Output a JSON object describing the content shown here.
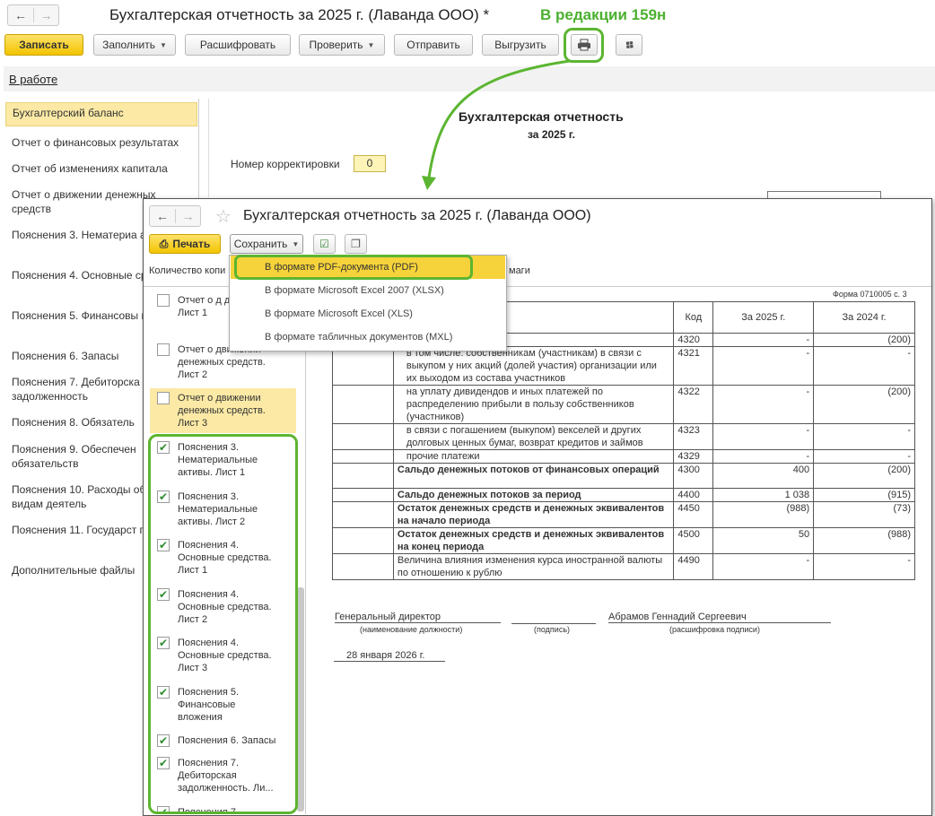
{
  "main_window": {
    "title": "Бухгалтерская отчетность за 2025 г. (Лаванда ООО) *",
    "edition_note": "В редакции 159н",
    "toolbar": {
      "save": "Записать",
      "fill": "Заполнить",
      "decode": "Расшифровать",
      "check": "Проверить",
      "send": "Отправить",
      "export": "Выгрузить"
    },
    "status_link": "В работе",
    "sidebar": [
      "Бухгалтерский баланс",
      "Отчет о финансовых результатах",
      "Отчет об изменениях капитала",
      "Отчет о движении денежных средств",
      "Пояснения 3. Нематериа активы",
      "Пояснения 4. Основные средства",
      "Пояснения 5. Финансовы вложения",
      "Пояснения 6. Запасы",
      "Пояснения 7. Дебиторска задолженность",
      "Пояснения 8. Обязатель",
      "Пояснения 9. Обеспечен обязательств",
      "Пояснения 10. Расходы обычным видам деятель",
      "Пояснения 11. Государст помощь",
      "Дополнительные файлы"
    ],
    "report_title": "Бухгалтерская отчетность",
    "report_year": "за 2025 г.",
    "correction_label": "Номер корректировки",
    "correction_value": "0"
  },
  "print_window": {
    "title": "Бухгалтерская отчетность за 2025 г. (Лаванда ООО)",
    "print_button": "Печать",
    "save_button": "Сохранить",
    "copies_label": "Количество копи",
    "paper_label": "маги",
    "save_menu": [
      "В формате PDF-документа (PDF)",
      "В формате Microsoft Excel 2007 (XLSX)",
      "В формате Microsoft Excel (XLS)",
      "В формате табличных документов (MXL)"
    ],
    "sections": [
      {
        "label": "Отчет о д денежных Лист 1",
        "checked": false
      },
      {
        "label": "Отчет о движении денежных средств. Лист 2",
        "checked": false
      },
      {
        "label": "Отчет о движении денежных средств. Лист 3",
        "checked": false
      },
      {
        "label": "Пояснения 3. Нематериальные активы. Лист 1",
        "checked": true
      },
      {
        "label": "Пояснения 3. Нематериальные активы. Лист 2",
        "checked": true
      },
      {
        "label": "Пояснения 4. Основные средства. Лист 1",
        "checked": true
      },
      {
        "label": "Пояснения 4. Основные средства. Лист 2",
        "checked": true
      },
      {
        "label": "Пояснения 4. Основные средства. Лист 3",
        "checked": true
      },
      {
        "label": "Пояснения 5. Финансовые вложения",
        "checked": true
      },
      {
        "label": "Пояснения 6. Запасы",
        "checked": true
      },
      {
        "label": "Пояснения 7. Дебиторская задолженность. Ли...",
        "checked": true
      },
      {
        "label": "Пояснения 7.",
        "checked": true
      }
    ],
    "form_code": "Форма 0710005 с. 3",
    "table_headers": {
      "name": "ование показателя",
      "code": "Код",
      "y2025": "За 2025 г.",
      "y2024": "За 2024 г."
    },
    "rows": [
      {
        "name": "",
        "code": "4320",
        "y2025": "-",
        "y2024": "(200)",
        "bold": false
      },
      {
        "name": "в том числе: собственникам (участникам) в связи с выкупом у них акций (долей участия) организации или их выходом из состава участников",
        "code": "4321",
        "y2025": "-",
        "y2024": "-",
        "bold": false
      },
      {
        "name": "на уплату дивидендов и иных платежей по распределению прибыли в пользу собственников (участников)",
        "code": "4322",
        "y2025": "-",
        "y2024": "(200)",
        "bold": false
      },
      {
        "name": "в связи с погашением (выкупом) векселей и других долговых ценных бумаг, возврат кредитов и займов",
        "code": "4323",
        "y2025": "-",
        "y2024": "-",
        "bold": false
      },
      {
        "name": "прочие платежи",
        "code": "4329",
        "y2025": "-",
        "y2024": "-",
        "bold": false
      },
      {
        "name": "Сальдо денежных потоков от финансовых операций",
        "code": "4300",
        "y2025": "400",
        "y2024": "(200)",
        "bold": true
      },
      {
        "name": "Сальдо денежных потоков за период",
        "code": "4400",
        "y2025": "1 038",
        "y2024": "(915)",
        "bold": true
      },
      {
        "name": "Остаток денежных средств и денежных эквивалентов на начало периода",
        "code": "4450",
        "y2025": "(988)",
        "y2024": "(73)",
        "bold": true
      },
      {
        "name": "Остаток денежных средств и денежных эквивалентов на конец периода",
        "code": "4500",
        "y2025": "50",
        "y2024": "(988)",
        "bold": true
      },
      {
        "name": "Величина влияния изменения курса иностранной валюты по отношению к рублю",
        "code": "4490",
        "y2025": "-",
        "y2024": "-",
        "bold": false
      }
    ],
    "signature": {
      "position": "Генеральный директор",
      "position_caption": "(наименование должности)",
      "sign_caption": "(подпись)",
      "name": "Абрамов Геннадий Сергеевич",
      "name_caption": "(расшифровка подписи)",
      "date": "28 января 2026 г."
    }
  },
  "colors": {
    "highlight_green": "#5cb531",
    "accent_yellow": "#f4c800",
    "selection": "#fbe9a5"
  }
}
